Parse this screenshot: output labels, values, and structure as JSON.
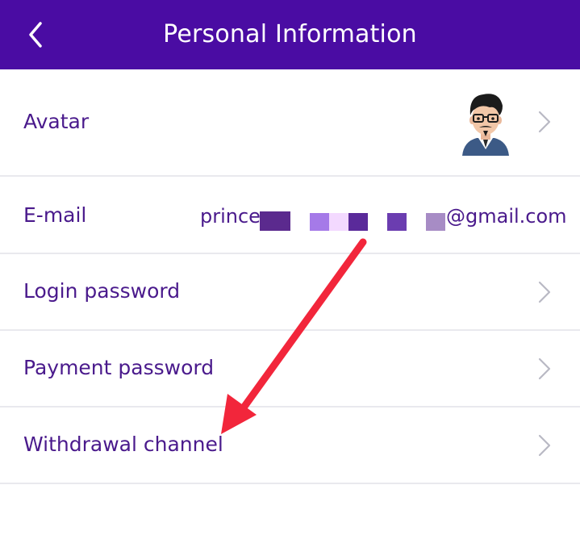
{
  "header": {
    "title": "Personal Information",
    "back_icon": "chevron-left-icon"
  },
  "rows": [
    {
      "label": "Avatar",
      "icon": "chevron-right-icon"
    },
    {
      "label": "E-mail",
      "value_prefix": "princea",
      "value_suffix": "@gmail.com"
    },
    {
      "label": "Login password",
      "icon": "chevron-right-icon"
    },
    {
      "label": "Payment password",
      "icon": "chevron-right-icon"
    },
    {
      "label": "Withdrawal channel",
      "icon": "chevron-right-icon"
    }
  ],
  "colors": {
    "header_bg": "#4a0ca3",
    "text": "#4a1a8c",
    "chevron": "#b9b9c4",
    "divider": "#e9e9ee",
    "annotation_arrow": "#f2263b"
  }
}
